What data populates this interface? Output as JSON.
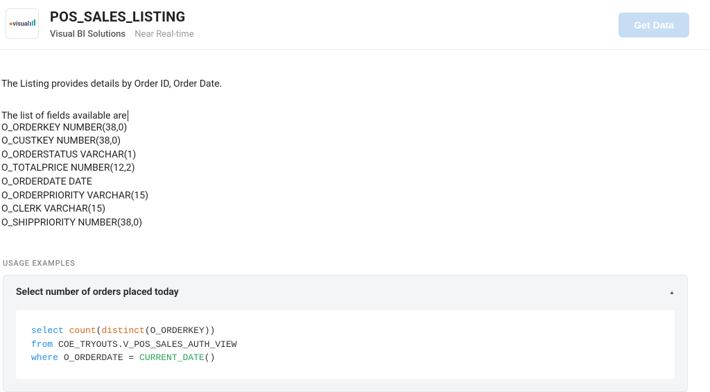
{
  "header": {
    "title": "POS_SALES_LISTING",
    "provider": "Visual BI Solutions",
    "freshness": "Near Real-time",
    "logo_text": "visual",
    "get_data_label": "Get Data"
  },
  "description": "The Listing provides details by Order ID, Order Date.",
  "fields_intro": "The list of fields available are",
  "fields": [
    "O_ORDERKEY NUMBER(38,0)",
    "O_CUSTKEY NUMBER(38,0)",
    "O_ORDERSTATUS VARCHAR(1)",
    "O_TOTALPRICE NUMBER(12,2)",
    "O_ORDERDATE DATE",
    "O_ORDERPRIORITY VARCHAR(15)",
    "O_CLERK VARCHAR(15)",
    "O_SHIPPRIORITY NUMBER(38,0)"
  ],
  "usage_section_label": "USAGE EXAMPLES",
  "example": {
    "title": "Select number of orders placed today",
    "sql": {
      "kw_select": "select",
      "fn_count": "count",
      "fn_distinct": "distinct",
      "col_orderkey": "(O_ORDERKEY))",
      "kw_from": "from",
      "table": " COE_TRYOUTS.V_POS_SALES_AUTH_VIEW",
      "kw_where": "where",
      "where_col": " O_ORDERDATE = ",
      "fn_current_date": "CURRENT_DATE",
      "parens": "()"
    }
  }
}
